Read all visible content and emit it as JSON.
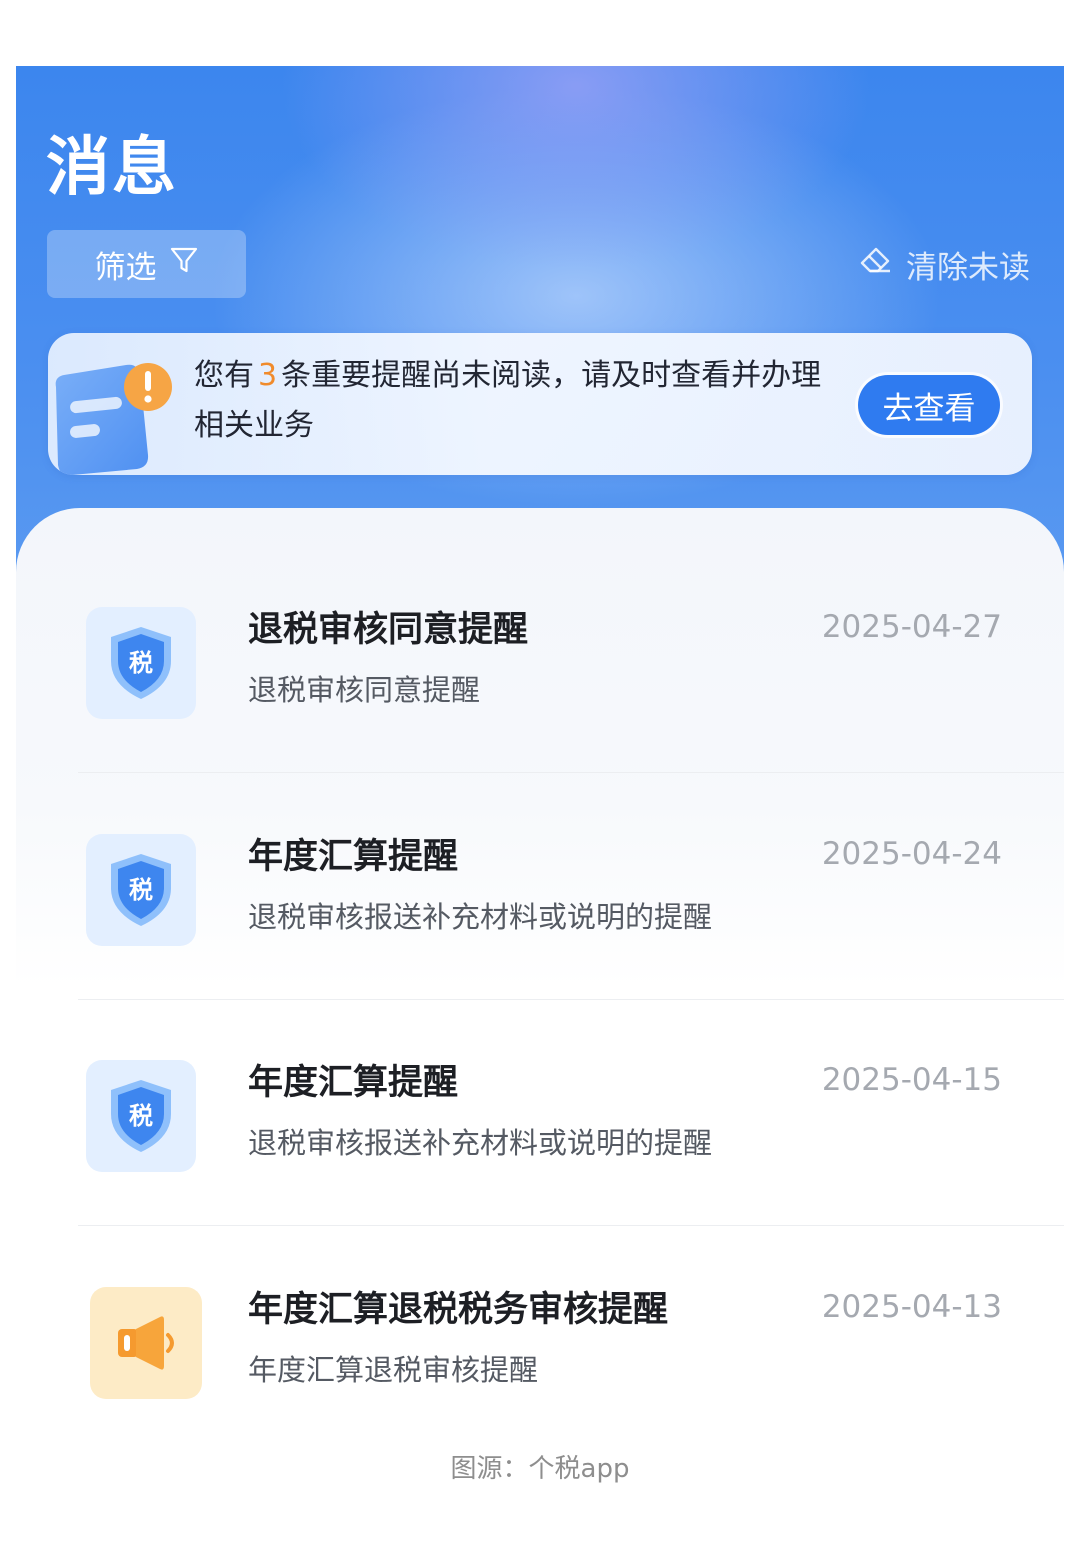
{
  "header": {
    "title": "消息",
    "filter_label": "筛选",
    "clear_unread_label": "清除未读"
  },
  "reminder_banner": {
    "text_before": "您有",
    "count": "3",
    "text_after": "条重要提醒尚未阅读，请及时查看并办理相关业务",
    "button_label": "去查看"
  },
  "messages": [
    {
      "title": "退税审核同意提醒",
      "description": "退税审核同意提醒",
      "date": "2025-04-27",
      "icon": "tax-shield-icon"
    },
    {
      "title": "年度汇算提醒",
      "description": "退税审核报送补充材料或说明的提醒",
      "date": "2025-04-24",
      "icon": "tax-shield-icon"
    },
    {
      "title": "年度汇算提醒",
      "description": "退税审核报送补充材料或说明的提醒",
      "date": "2025-04-15",
      "icon": "tax-shield-icon"
    },
    {
      "title": "年度汇算退税税务审核提醒",
      "description": "年度汇算退税审核提醒",
      "date": "2025-04-13",
      "icon": "megaphone-icon"
    }
  ],
  "shield_glyph": "税",
  "caption": "图源：个税app",
  "colors": {
    "header_blue": "#3c86ee",
    "button_blue": "#2f7bf0",
    "highlight_orange": "#f08b2c",
    "icon_bg_blue": "#e3efff",
    "icon_bg_orange": "#fdebc6"
  }
}
